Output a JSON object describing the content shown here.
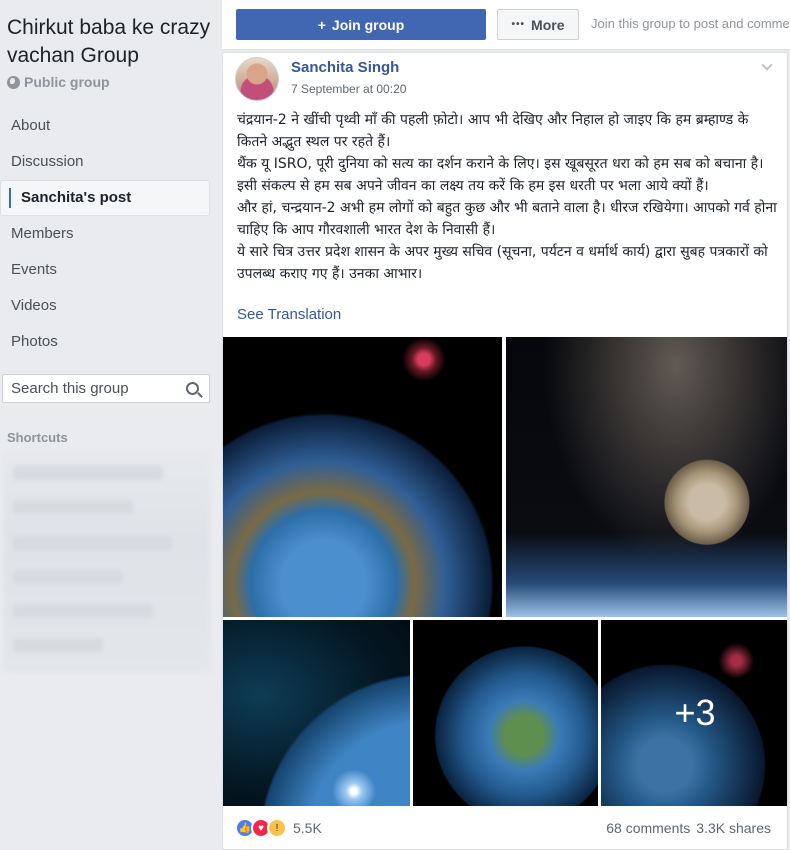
{
  "group": {
    "title": "Chirkut baba ke crazy vachan Group",
    "privacy": "Public group"
  },
  "sidebar": {
    "items": [
      {
        "label": "About"
      },
      {
        "label": "Discussion"
      },
      {
        "label": "Sanchita's post",
        "active": true
      },
      {
        "label": "Members"
      },
      {
        "label": "Events"
      },
      {
        "label": "Videos"
      },
      {
        "label": "Photos"
      }
    ],
    "search_placeholder": "Search this group",
    "shortcuts_label": "Shortcuts"
  },
  "topbar": {
    "join_label": "Join group",
    "more_label": "More",
    "join_hint": "Join this group to post and comment."
  },
  "post": {
    "author": "Sanchita Singh",
    "timestamp": "7 September at 00:20",
    "paragraphs": [
      "चंद्रयान-2 ने खींची पृथ्वी माँ की पहली फ़ोटो। आप भी देखिए और निहाल हो जाइए कि हम ब्रम्हाण्ड के कितने अद्भुत स्थल पर रहते हैं।",
      "थैंक यू ISRO, पूरी दुनिया को सत्य का दर्शन कराने के लिए। इस खूबसूरत धरा को हम सब को बचाना है। इसी संकल्प से हम सब अपने जीवन का लक्ष्य तय करें कि हम इस धरती पर भला आये क्यों हैं।",
      "और हां, चन्द्रयान-2 अभी हम लोगों को बहुत कुछ और भी बताने वाला है। धीरज रखियेगा। आपको गर्व होना चाहिए कि आप गौरवशाली भारत देश के निवासी हैं।",
      "ये सारे चित्र उत्तर प्रदेश शासन के अपर मुख्य सचिव (सूचना, पर्यटन व धर्मार्थ कार्य) द्वारा सुबह पत्रकारों को उपलब्ध कराए गए हैं। उनका आभार।"
    ],
    "see_translation": "See Translation",
    "more_photos_label": "+3",
    "reaction_count": "5.5K",
    "comments": "68 comments",
    "shares": "3.3K shares"
  },
  "icons": {
    "globe": "globe-icon",
    "plus": "plus-icon",
    "search": "search-icon",
    "chevron": "chevron-down-icon",
    "like": "like-icon",
    "love": "love-icon",
    "wow": "wow-icon"
  },
  "colors": {
    "brand": "#4267b2",
    "link": "#365899",
    "background": "#e9ebee"
  }
}
